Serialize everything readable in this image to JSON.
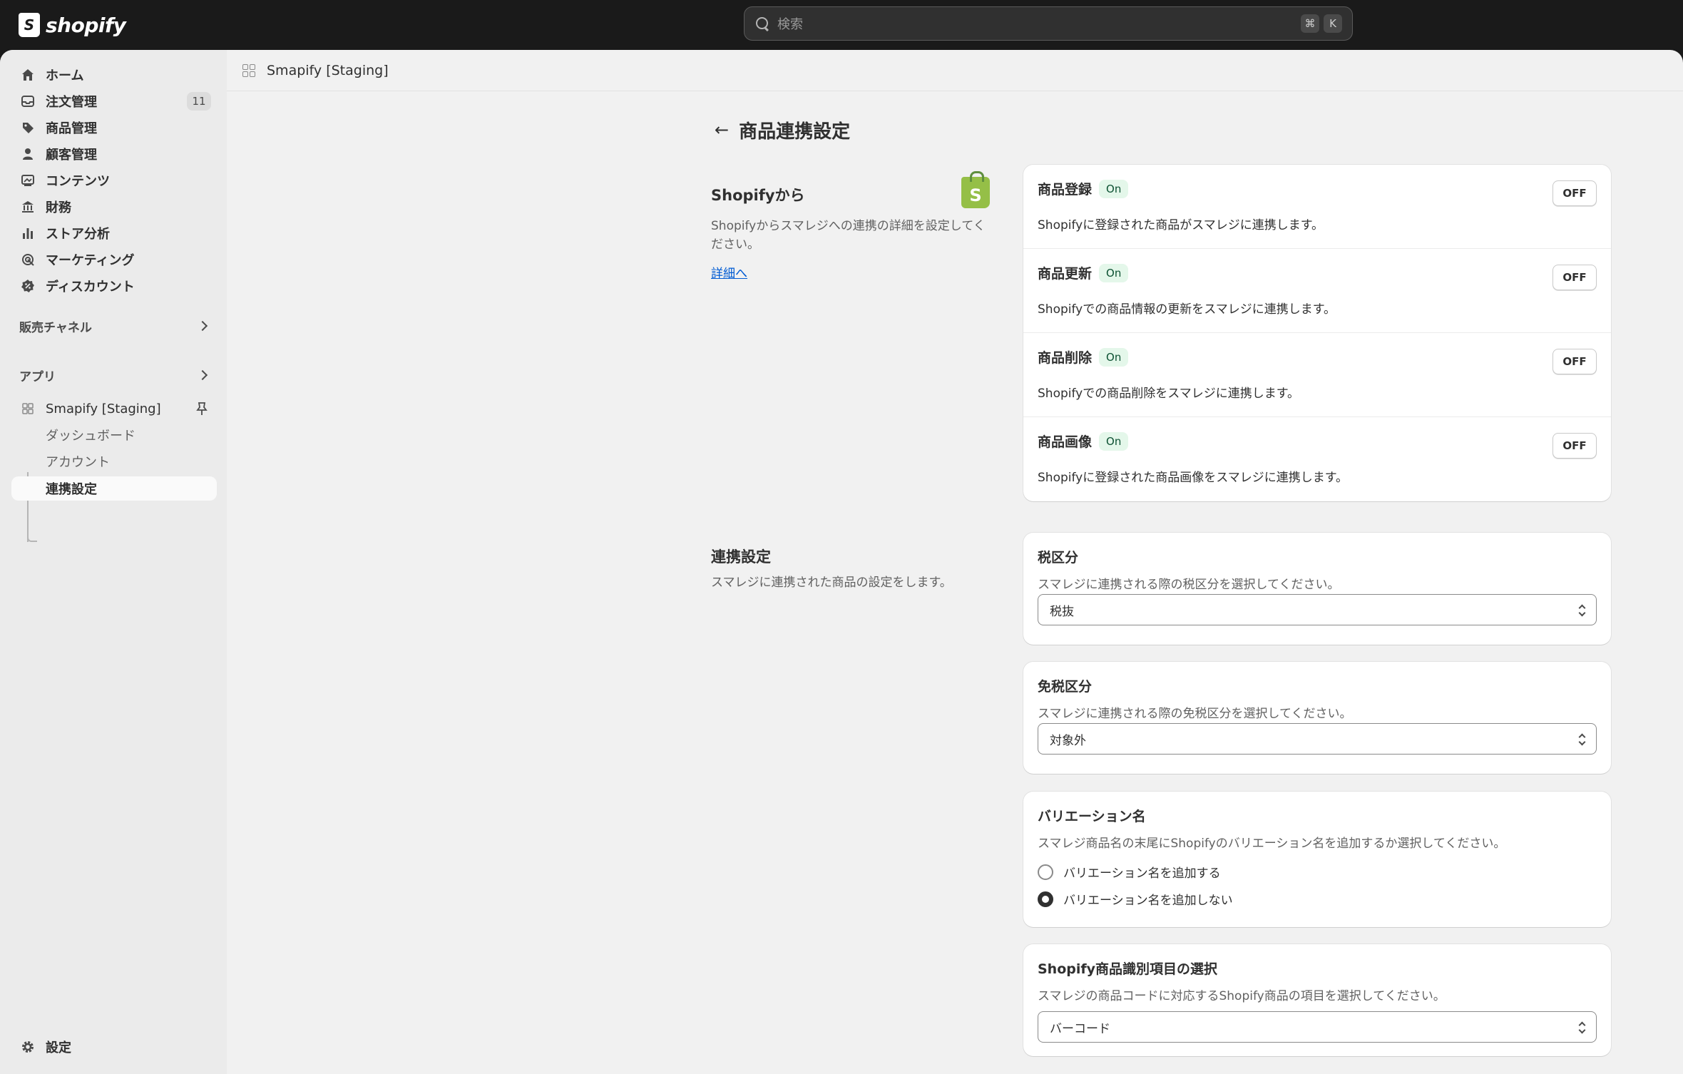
{
  "topbar": {
    "logo_text": "shopify",
    "search_placeholder": "検索",
    "shortcut_keys": [
      "⌘",
      "K"
    ]
  },
  "sidebar": {
    "items": [
      {
        "label": "ホーム",
        "icon": "home-icon"
      },
      {
        "label": "注文管理",
        "icon": "inbox-icon",
        "badge": "11"
      },
      {
        "label": "商品管理",
        "icon": "tag-icon"
      },
      {
        "label": "顧客管理",
        "icon": "person-icon"
      },
      {
        "label": "コンテンツ",
        "icon": "image-icon"
      },
      {
        "label": "財務",
        "icon": "bank-icon"
      },
      {
        "label": "ストア分析",
        "icon": "bar-chart-icon"
      },
      {
        "label": "マーケティング",
        "icon": "target-icon"
      },
      {
        "label": "ディスカウント",
        "icon": "discount-icon"
      }
    ],
    "sales_channels": "販売チャネル",
    "apps": "アプリ",
    "app_name": "Smapify [Staging]",
    "app_subitems": [
      "ダッシュボード",
      "アカウント",
      "連携設定"
    ],
    "active_subitem": "連携設定",
    "settings": "設定"
  },
  "appbar": {
    "title": "Smapify [Staging]"
  },
  "page": {
    "title": "商品連携設定"
  },
  "from_shopify": {
    "title": "Shopifyから",
    "desc_line1": "Shopifyからスマレジへの連携の詳細を設定してく",
    "desc_line2": "ださい。",
    "link": "詳細へ",
    "rows": [
      {
        "title": "商品登録",
        "status": "On",
        "button": "OFF",
        "desc": "Shopifyに登録された商品がスマレジに連携します。"
      },
      {
        "title": "商品更新",
        "status": "On",
        "button": "OFF",
        "desc": "Shopifyでの商品情報の更新をスマレジに連携します。"
      },
      {
        "title": "商品削除",
        "status": "On",
        "button": "OFF",
        "desc": "Shopifyでの商品削除をスマレジに連携します。"
      },
      {
        "title": "商品画像",
        "status": "On",
        "button": "OFF",
        "desc": "Shopifyに登録された商品画像をスマレジに連携します。"
      }
    ]
  },
  "link_settings": {
    "title": "連携設定",
    "desc": "スマレジに連携された商品の設定をします。",
    "tax": {
      "title": "税区分",
      "desc": "スマレジに連携される際の税区分を選択してください。",
      "value": "税抜"
    },
    "tax_free": {
      "title": "免税区分",
      "desc": "スマレジに連携される際の免税区分を選択してください。",
      "value": "対象外"
    },
    "variation": {
      "title": "バリエーション名",
      "desc": "スマレジ商品名の末尾にShopifyのバリエーション名を追加するか選択してください。",
      "options": [
        "バリエーション名を追加する",
        "バリエーション名を追加しない"
      ],
      "selected": "バリエーション名を追加しない"
    },
    "identifier": {
      "title": "Shopify商品識別項目の選択",
      "desc": "スマレジの商品コードに対応するShopify商品の項目を選択してください。",
      "value": "バーコード"
    }
  }
}
